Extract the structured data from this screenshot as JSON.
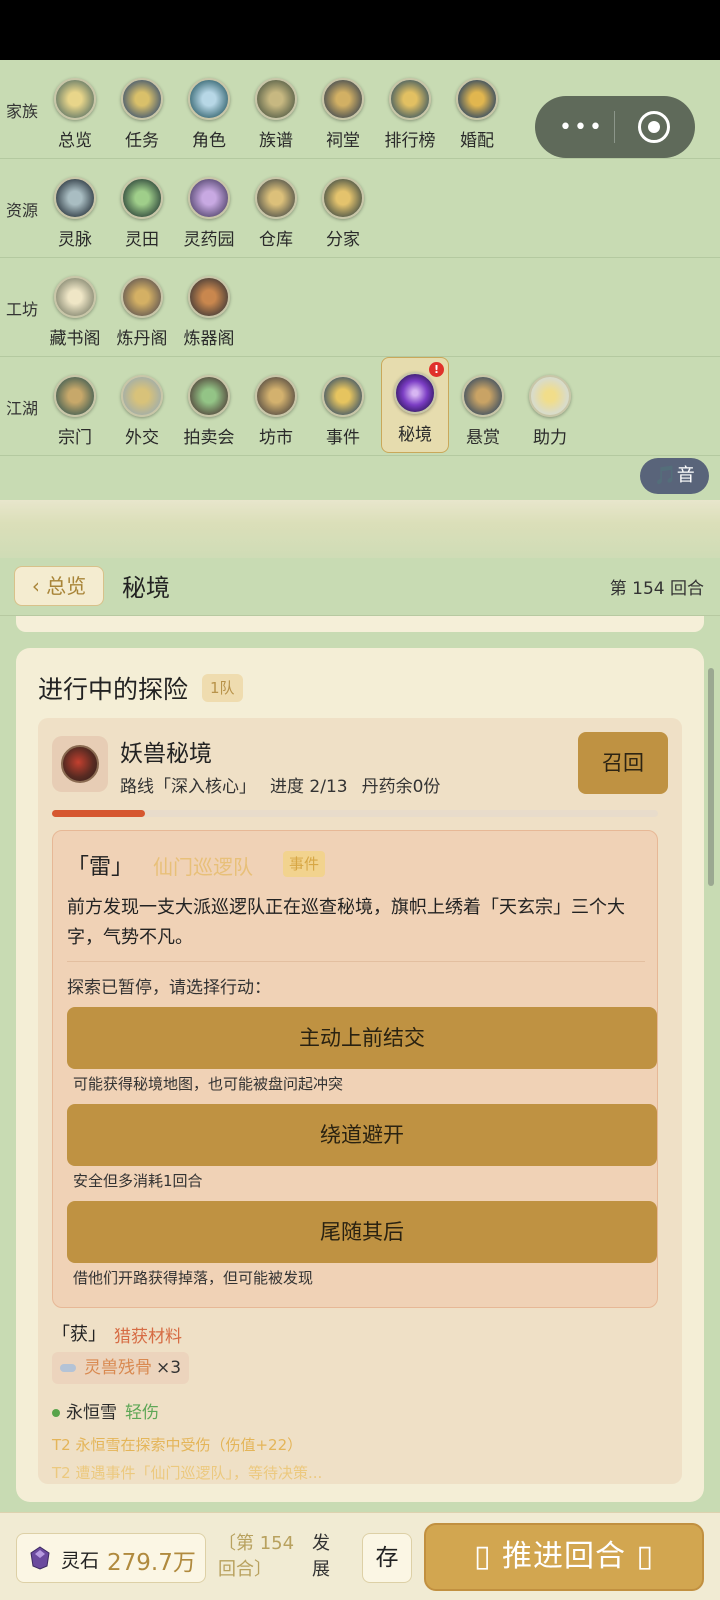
{
  "nav": {
    "rows": [
      {
        "category": "家族",
        "items": [
          {
            "label": "总览",
            "icon": "overview-icon"
          },
          {
            "label": "任务",
            "icon": "task-icon"
          },
          {
            "label": "角色",
            "icon": "character-icon"
          },
          {
            "label": "族谱",
            "icon": "family-tree-icon"
          },
          {
            "label": "祠堂",
            "icon": "ancestral-hall-icon"
          },
          {
            "label": "排行榜",
            "icon": "ranking-icon"
          },
          {
            "label": "婚配",
            "icon": "marriage-icon"
          }
        ]
      },
      {
        "category": "资源",
        "items": [
          {
            "label": "灵脉",
            "icon": "spirit-vein-icon"
          },
          {
            "label": "灵田",
            "icon": "spirit-field-icon"
          },
          {
            "label": "灵药园",
            "icon": "herb-garden-icon"
          },
          {
            "label": "仓库",
            "icon": "warehouse-icon"
          },
          {
            "label": "分家",
            "icon": "branch-family-icon"
          }
        ]
      },
      {
        "category": "工坊",
        "items": [
          {
            "label": "藏书阁",
            "icon": "library-icon"
          },
          {
            "label": "炼丹阁",
            "icon": "alchemy-icon"
          },
          {
            "label": "炼器阁",
            "icon": "forge-icon"
          }
        ]
      },
      {
        "category": "江湖",
        "items": [
          {
            "label": "宗门",
            "icon": "sect-icon"
          },
          {
            "label": "外交",
            "icon": "diplomacy-icon"
          },
          {
            "label": "拍卖会",
            "icon": "auction-icon"
          },
          {
            "label": "坊市",
            "icon": "market-icon"
          },
          {
            "label": "事件",
            "icon": "event-icon"
          },
          {
            "label": "秘境",
            "icon": "secret-realm-icon",
            "active": true,
            "badge": "!"
          },
          {
            "label": "悬赏",
            "icon": "bounty-icon"
          },
          {
            "label": "助力",
            "icon": "support-icon"
          }
        ]
      }
    ],
    "music_label": "🎵音"
  },
  "header": {
    "back_label": "‹ 总览",
    "title": "秘境",
    "round": "第 154 回合"
  },
  "card": {
    "title": "进行中的探险",
    "team_count": "1队",
    "expedition": {
      "name": "妖兽秘境",
      "route": "路线「深入核心」",
      "progress_text": "进度 2/13",
      "pills": "丹药余0份",
      "recall_label": "召回",
      "progress": 0.154,
      "event": {
        "head": "「雷」",
        "name": "仙门巡逻队",
        "tag": "事件",
        "description": "前方发现一支大派巡逻队正在巡查秘境，旗帜上绣着「天玄宗」三个大字，气势不凡。",
        "prompt": "探索已暂停，请选择行动：",
        "choices": [
          {
            "label": "主动上前结交",
            "hint": "可能获得秘境地图，也可能被盘问起冲突"
          },
          {
            "label": "绕道避开",
            "hint": "安全但多消耗1回合"
          },
          {
            "label": "尾随其后",
            "hint": "借他们开路获得掉落，但可能被发现"
          }
        ]
      },
      "loot": {
        "head": "「获」",
        "title": "猎获材料",
        "item_name": "灵兽残骨",
        "item_count": "×3"
      },
      "member": {
        "name": "永恒雪",
        "status": "轻伤"
      },
      "logs": [
        "T2 永恒雪在探索中受伤（伤值+22）",
        "T2 遭遇事件「仙门巡逻队」，等待决策..."
      ]
    }
  },
  "bottom": {
    "stone_label": "灵石",
    "stone_value": "279.7万",
    "round_text": "〔第 154 回合〕",
    "develop_text": "发展",
    "save_label": "存",
    "advance_label": "▯ 推进回合 ▯"
  },
  "colors": {
    "accent": "#bf9242",
    "background": "#c8dbb3",
    "card": "#f4eed6",
    "badge": "#e0312b",
    "progress": "#d6572f"
  }
}
